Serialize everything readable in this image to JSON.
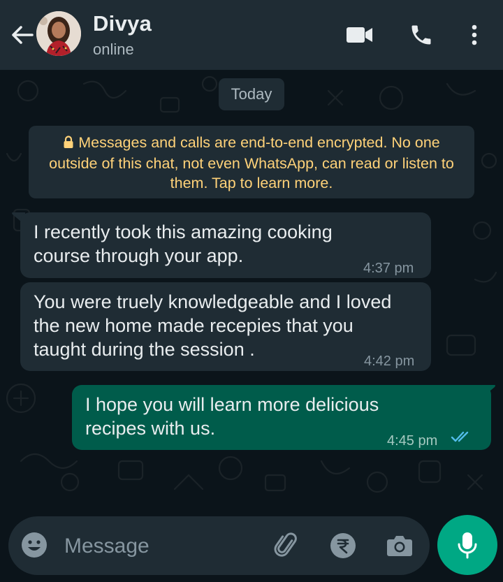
{
  "header": {
    "contact_name": "Divya",
    "status": "online",
    "icons": [
      "back-arrow-icon",
      "video-call-icon",
      "voice-call-icon",
      "more-options-icon"
    ]
  },
  "chat": {
    "date_label": "Today",
    "encryption_notice": "Messages and calls are end-to-end encrypted. No one outside of this chat, not even WhatsApp, can read or listen to them. Tap to learn more.",
    "messages": [
      {
        "direction": "incoming",
        "lines": [
          "I recently took this amazing cooking",
          "course through your app."
        ],
        "time": "4:37 pm"
      },
      {
        "direction": "incoming",
        "lines": [
          "You were truely knowledgeable and I loved",
          "the new home made recepies that you",
          "taught during the session ."
        ],
        "time": "4:42 pm"
      },
      {
        "direction": "outgoing",
        "lines": [
          "I hope you will learn more delicious",
          "recipes with us."
        ],
        "time": "4:45 pm",
        "receipt": "read"
      }
    ]
  },
  "composer": {
    "placeholder": "Message",
    "icons": [
      "emoji-icon",
      "attach-icon",
      "rupee-payment-icon",
      "camera-icon",
      "microphone-icon"
    ]
  },
  "colors": {
    "header_bg": "#1f2c34",
    "chat_bg": "#0b141a",
    "incoming_bubble": "#1f2c34",
    "outgoing_bubble": "#005c4b",
    "notice_text": "#ffd279",
    "accent": "#00a884",
    "read_tick": "#53bdeb"
  }
}
